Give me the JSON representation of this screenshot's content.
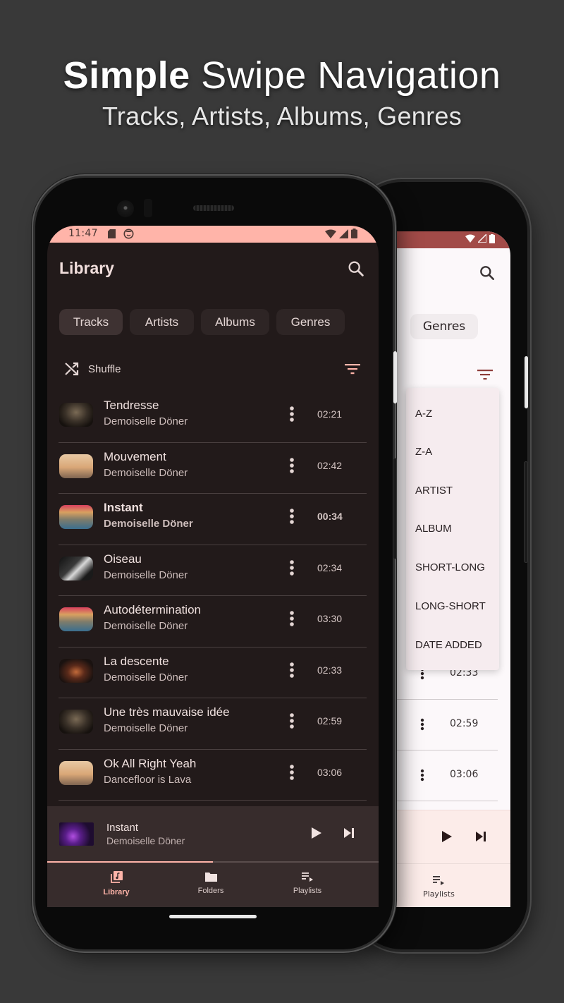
{
  "promo": {
    "headline_bold": "Simple",
    "headline_rest": "Swipe Navigation",
    "subline": "Tracks, Artists, Albums, Genres"
  },
  "colors": {
    "accent": "#ffb4a9",
    "surface_dark": "#221a1a",
    "surface_light": "#fcf8fa",
    "status_light": "#a24b48"
  },
  "front_phone": {
    "status_bar": {
      "time": "11:47",
      "icons": [
        "sd-card-icon",
        "face-icon",
        "wifi-icon",
        "signal-icon",
        "battery-icon"
      ]
    },
    "app_bar": {
      "title": "Library",
      "search_icon": "search-icon"
    },
    "tabs": [
      {
        "label": "Tracks",
        "active": true
      },
      {
        "label": "Artists",
        "active": false
      },
      {
        "label": "Albums",
        "active": false
      },
      {
        "label": "Genres",
        "active": false
      }
    ],
    "shuffle_label": "Shuffle",
    "tracks": [
      {
        "title": "Tendresse",
        "artist": "Demoiselle Döner",
        "duration": "02:21",
        "playing": false,
        "art": "singer"
      },
      {
        "title": "Mouvement",
        "artist": "Demoiselle Döner",
        "duration": "02:42",
        "playing": false,
        "art": "sunset"
      },
      {
        "title": "Instant",
        "artist": "Demoiselle Döner",
        "duration": "00:34",
        "playing": true,
        "art": "crowd"
      },
      {
        "title": "Oiseau",
        "artist": "Demoiselle Döner",
        "duration": "02:34",
        "playing": false,
        "art": "piano"
      },
      {
        "title": "Autodétermination",
        "artist": "Demoiselle Döner",
        "duration": "03:30",
        "playing": false,
        "art": "crowd"
      },
      {
        "title": "La descente",
        "artist": "Demoiselle Döner",
        "duration": "02:33",
        "playing": false,
        "art": "fire"
      },
      {
        "title": "Une très mauvaise idée",
        "artist": "Demoiselle Döner",
        "duration": "02:59",
        "playing": false,
        "art": "singer"
      },
      {
        "title": "Ok All Right Yeah",
        "artist": "Dancefloor is Lava",
        "duration": "03:06",
        "playing": false,
        "art": "sunset"
      }
    ],
    "mini_player": {
      "title": "Instant",
      "artist": "Demoiselle Döner",
      "progress": 0.5
    },
    "bottom_nav": [
      {
        "label": "Library",
        "icon": "library-music-icon",
        "active": true
      },
      {
        "label": "Folders",
        "icon": "folder-icon",
        "active": false
      },
      {
        "label": "Playlists",
        "icon": "playlist-play-icon",
        "active": false
      }
    ]
  },
  "back_phone": {
    "visible_tab": "Genres",
    "sort_menu": [
      "A-Z",
      "Z-A",
      "ARTIST",
      "ALBUM",
      "SHORT-LONG",
      "LONG-SHORT",
      "DATE ADDED"
    ],
    "visible_durations": [
      "02:33",
      "02:59",
      "03:06"
    ],
    "bottom_nav_visible": "Playlists"
  }
}
